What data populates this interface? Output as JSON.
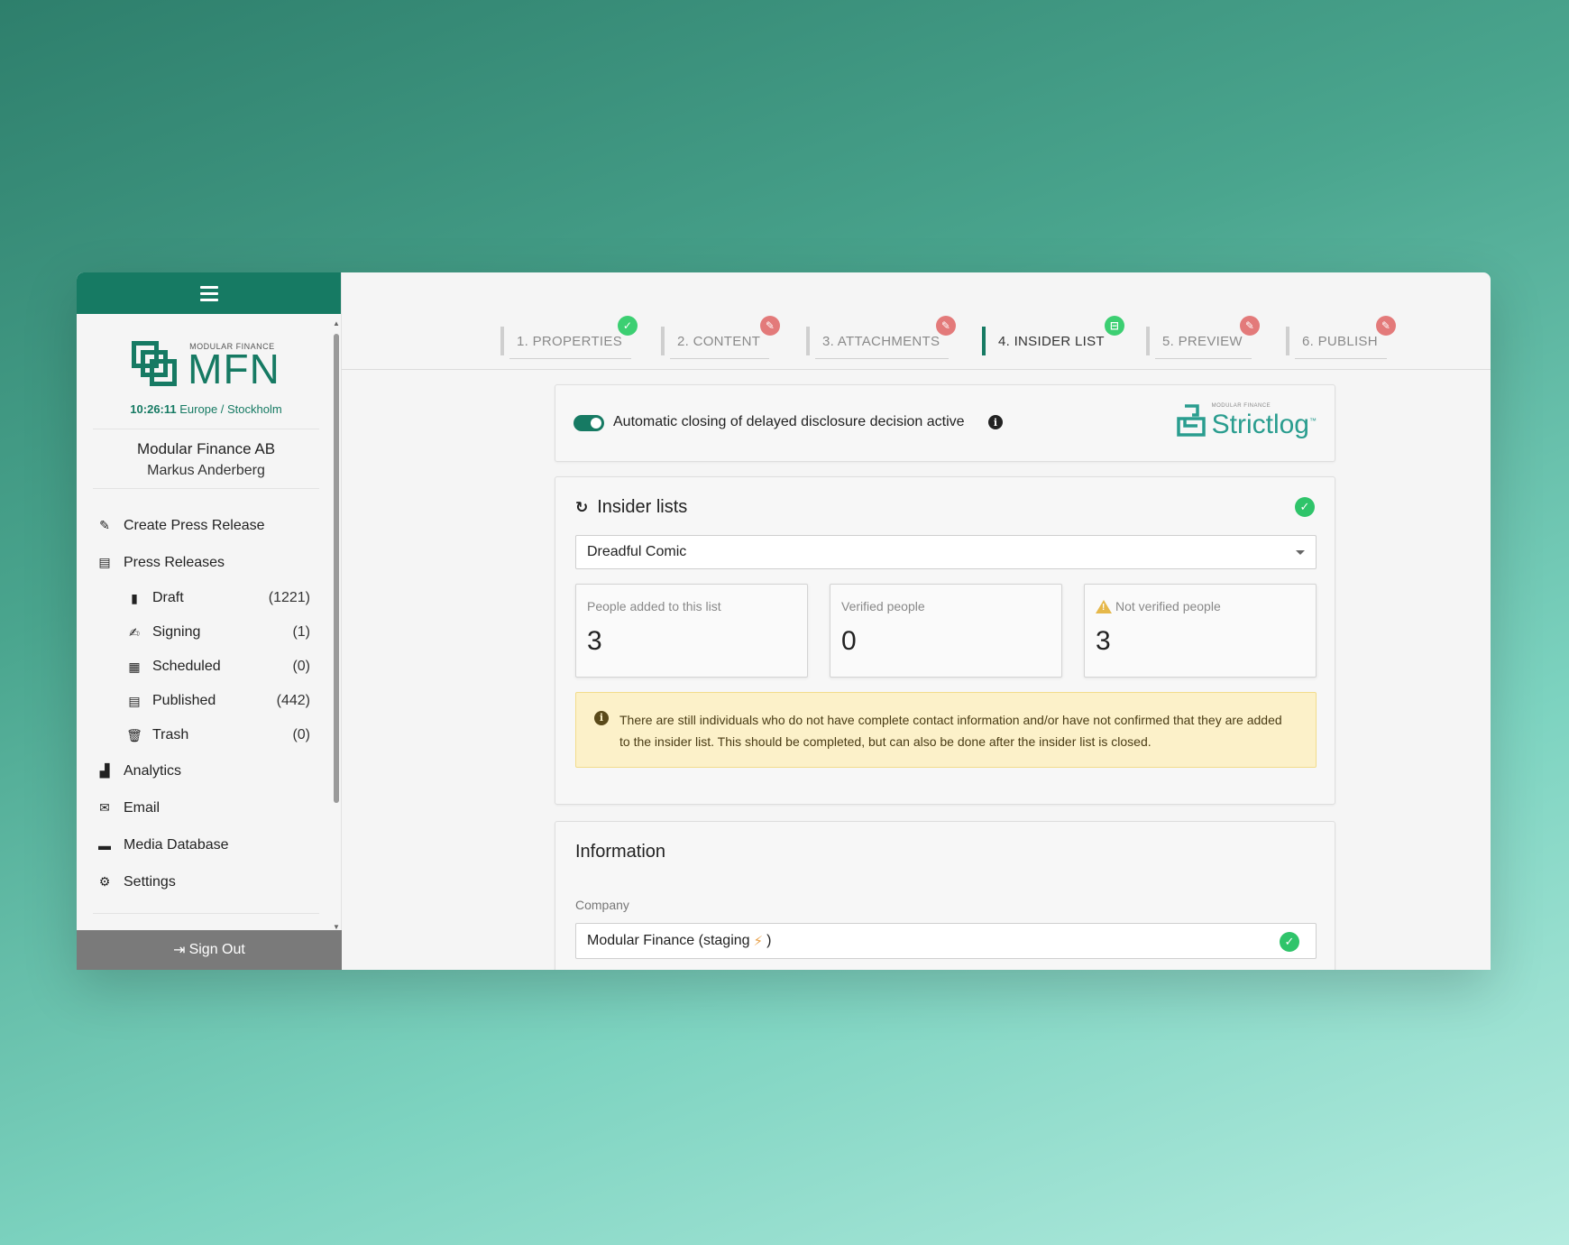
{
  "sidebar": {
    "logo": {
      "small": "MODULAR FINANCE",
      "big": "MFN"
    },
    "clock": {
      "time": "10:26:11",
      "zone": "Europe / Stockholm"
    },
    "company": "Modular Finance AB",
    "user": "Markus Anderberg",
    "nav": {
      "create": "Create Press Release",
      "press_releases": "Press Releases",
      "sub": [
        {
          "label": "Draft",
          "count": "(1221)"
        },
        {
          "label": "Signing",
          "count": "(1)"
        },
        {
          "label": "Scheduled",
          "count": "(0)"
        },
        {
          "label": "Published",
          "count": "(442)"
        },
        {
          "label": "Trash",
          "count": "(0)"
        }
      ],
      "analytics": "Analytics",
      "email": "Email",
      "media": "Media Database",
      "settings": "Settings"
    },
    "signout": "Sign Out"
  },
  "steps": [
    {
      "label": "1. PROPERTIES",
      "status": "ok"
    },
    {
      "label": "2. CONTENT",
      "status": "edit"
    },
    {
      "label": "3. ATTACHMENTS",
      "status": "edit"
    },
    {
      "label": "4. INSIDER LIST",
      "status": "strictlog"
    },
    {
      "label": "5. PREVIEW",
      "status": "edit"
    },
    {
      "label": "6. PUBLISH",
      "status": "edit"
    }
  ],
  "disclosure": {
    "text": "Automatic closing of delayed disclosure decision active",
    "toggle_on": true,
    "brand_small": "MODULAR FINANCE",
    "brand": "Strictlog",
    "brand_tm": "™"
  },
  "insider": {
    "title": "Insider lists",
    "selected_list": "Dreadful Comic",
    "stats": [
      {
        "label": "People added to this list",
        "value": "3"
      },
      {
        "label": "Verified people",
        "value": "0"
      },
      {
        "label": "Not verified people",
        "value": "3"
      }
    ],
    "alert": "There are still individuals who do not have complete contact information and/or have not confirmed that they are added to the insider list. This should be completed, but can also be done after the insider list is closed."
  },
  "information": {
    "title": "Information",
    "company_label": "Company",
    "company_value": "Modular Finance (staging",
    "company_suffix": ")"
  },
  "colors": {
    "brand": "#167a63",
    "ok": "#3ccf72",
    "edit": "#e37a7a",
    "warning": "#fcf1c9"
  }
}
